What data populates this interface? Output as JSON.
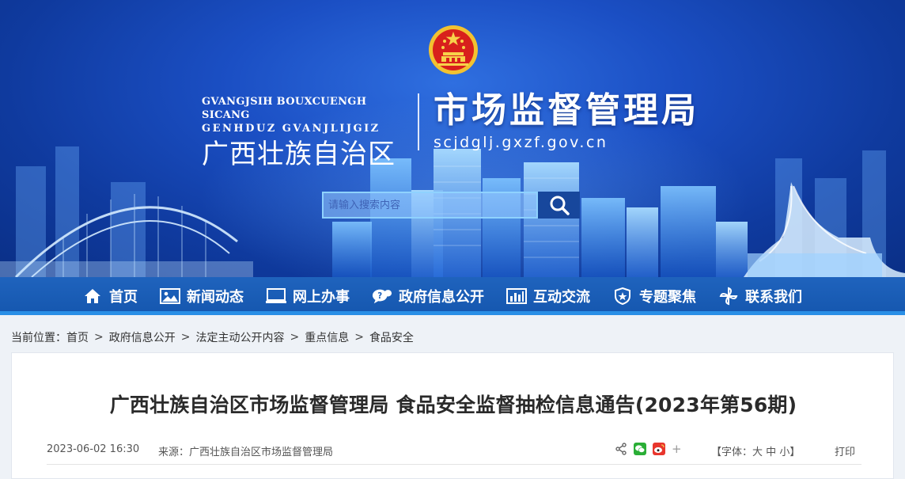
{
  "header": {
    "emblem": "national-emblem",
    "en_line1": "GVANGJSIH BOUXCUENGH SICANG",
    "en_line2": "GENHDUZ GVANJLIJGIZ",
    "cn_region": "广西壮族自治区",
    "site_title": "市场监督管理局",
    "domain": "scjdglj.gxzf.gov.cn"
  },
  "search": {
    "placeholder": "请输入搜索内容",
    "icon": "search-icon"
  },
  "nav": {
    "items": [
      {
        "label": "首页",
        "icon": "home-icon"
      },
      {
        "label": "新闻动态",
        "icon": "image-icon"
      },
      {
        "label": "网上办事",
        "icon": "monitor-icon"
      },
      {
        "label": "政府信息公开",
        "icon": "speech-bubble-icon"
      },
      {
        "label": "互动交流",
        "icon": "bar-chart-icon"
      },
      {
        "label": "专题聚焦",
        "icon": "shield-star-icon"
      },
      {
        "label": "联系我们",
        "icon": "pinwheel-icon"
      }
    ]
  },
  "breadcrumb": {
    "prefix": "当前位置：",
    "items": [
      "首页",
      "政府信息公开",
      "法定主动公开内容",
      "重点信息",
      "食品安全"
    ],
    "separator": ">"
  },
  "article": {
    "title": "广西壮族自治区市场监督管理局 食品安全监督抽检信息通告(2023年第56期)",
    "date": "2023-06-02 16:30",
    "source": "来源：广西壮族自治区市场监督管理局",
    "share_icons": [
      "share-icon",
      "wechat-icon",
      "weibo-icon",
      "plus-icon"
    ],
    "plus": "+",
    "font_label_open": "【字体：",
    "font_sizes": [
      "大",
      "中",
      "小"
    ],
    "font_label_close": "】",
    "print": "打印"
  },
  "colors": {
    "banner_blue": "#1b4fc4",
    "nav_blue": "#1f63bd",
    "nav_accent": "#2a8fe6",
    "search_button": "#17479c"
  }
}
